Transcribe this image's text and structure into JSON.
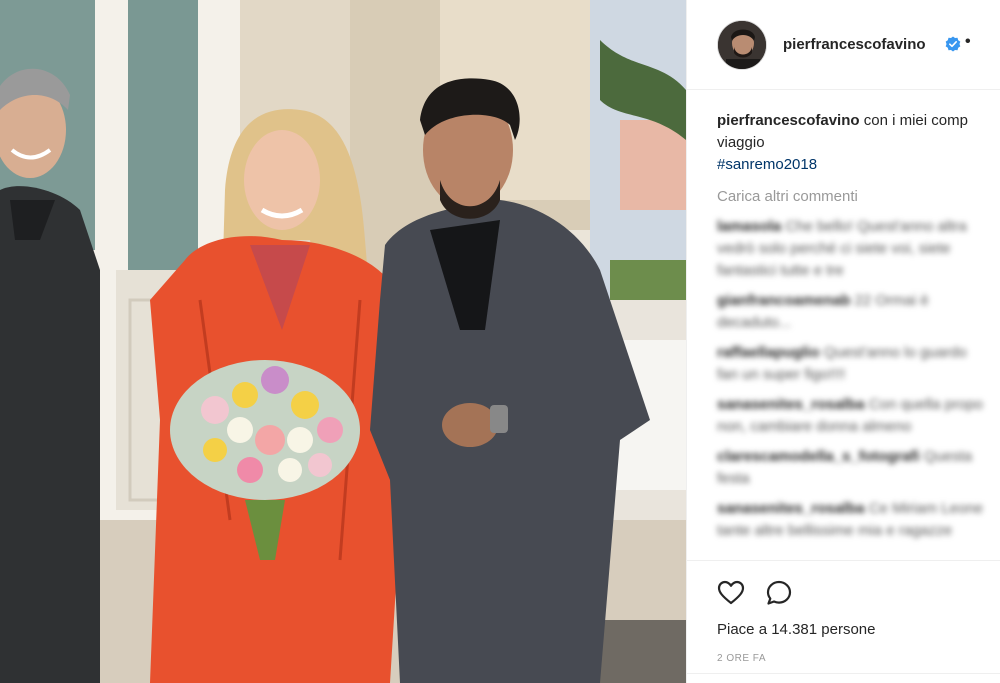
{
  "post": {
    "username": "pierfrancescofavino",
    "verified_icon": "verified-badge-icon",
    "separator": "•",
    "caption_user": "pierfrancescofavino",
    "caption_text": "con i miei comp",
    "caption_line2": "viaggio",
    "hashtag": "#sanremo2018",
    "load_more": "Carica altri commenti",
    "comments": [
      {
        "user": "lamasola",
        "text": "Che bello! Quest'anno altra"
      },
      {
        "user": "",
        "text": "vedrò solo perché ci siete voi, siete"
      },
      {
        "user": "",
        "text": "fantastici tutte e tre"
      },
      {
        "user": "gianfrancoamenab",
        "text": "22 Ormai è"
      },
      {
        "user": "",
        "text": "decaduto..."
      },
      {
        "user": "raffaellapuglio",
        "text": "Quest'anno lo guardo"
      },
      {
        "user": "",
        "text": "fan un super figo!!!!"
      },
      {
        "user": "sanasenites_rosalba",
        "text": "Con quella propo"
      },
      {
        "user": "",
        "text": "non, cambiare donna almeno"
      },
      {
        "user": "clarescamodella_s_fotografi",
        "text": "Questa"
      },
      {
        "user": "",
        "text": "festa"
      },
      {
        "user": "sanasenites_rosalba",
        "text": "Ce Miriam Leone"
      },
      {
        "user": "",
        "text": "tante altre bellissime mia e ragazze"
      }
    ],
    "likes_prefix": "Piace a",
    "likes_count": "14.381",
    "likes_suffix": "persone",
    "time_ago": "2 ORE FA"
  },
  "icons": {
    "like": "heart-icon",
    "comment": "comment-icon"
  },
  "colors": {
    "verified": "#3897f0",
    "hashtag": "#003569",
    "muted": "#999999",
    "border": "#efefef"
  }
}
